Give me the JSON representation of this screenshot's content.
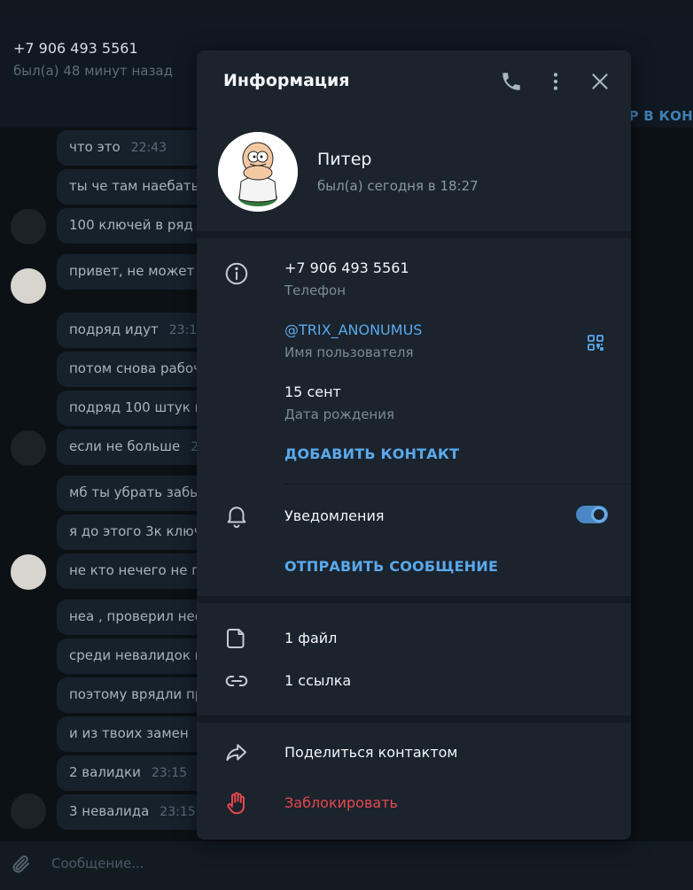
{
  "chat": {
    "title": "+7 906 493 5561",
    "status": "был(а) 48 минут назад",
    "action_label": "ЕР В КОН",
    "messages": [
      {
        "text": "что это",
        "time": "22:43"
      },
      {
        "text": "ты че там наебать",
        "time": ""
      },
      {
        "text": "100 ключей в ряд н",
        "time": ""
      },
      {
        "text": "привет, не может б",
        "time": ""
      },
      {
        "text": "подряд идут",
        "time": "23:1"
      },
      {
        "text": "потом снова рабоч",
        "time": ""
      },
      {
        "text": "подряд 100 штук н",
        "time": ""
      },
      {
        "text": "если не больше",
        "time": "2"
      },
      {
        "text": "мб ты убрать забы",
        "time": ""
      },
      {
        "text": "я до этого 3к ключ",
        "time": ""
      },
      {
        "text": "не кто нечего не п",
        "time": ""
      },
      {
        "text": "неа , проверил нес",
        "time": ""
      },
      {
        "text": "среди невалидок г",
        "time": ""
      },
      {
        "text": "поэтому врядли пр",
        "time": ""
      },
      {
        "text": "и из твоих замен",
        "time": ""
      },
      {
        "text": "2 валидки",
        "time": "23:15"
      },
      {
        "text": "3 невалида",
        "time": "23:15"
      }
    ],
    "composer_placeholder": "Сообщение..."
  },
  "info": {
    "title": "Информация",
    "header_icons": [
      "phone-icon",
      "more-vertical-icon",
      "close-icon"
    ],
    "profile": {
      "name": "Питер",
      "status": "был(а) сегодня в 18:27"
    },
    "phone": {
      "value": "+7 906 493 5561",
      "label": "Телефон"
    },
    "username": {
      "value": "@TRIX_ANONUMUS",
      "label": "Имя пользователя"
    },
    "birthday": {
      "value": "15 сент",
      "label": "Дата рождения"
    },
    "add_contact": "ДОБАВИТЬ КОНТАКТ",
    "notifications": {
      "label": "Уведомления",
      "enabled": true
    },
    "send_message": "ОТПРАВИТЬ СООБЩЕНИЕ",
    "files": "1 файл",
    "links": "1 ссылка",
    "share_contact": "Поделиться контактом",
    "block": "Заблокировать"
  },
  "colors": {
    "accent": "#5aa9ec",
    "danger": "#e5484d",
    "panel": "#1b232d"
  }
}
